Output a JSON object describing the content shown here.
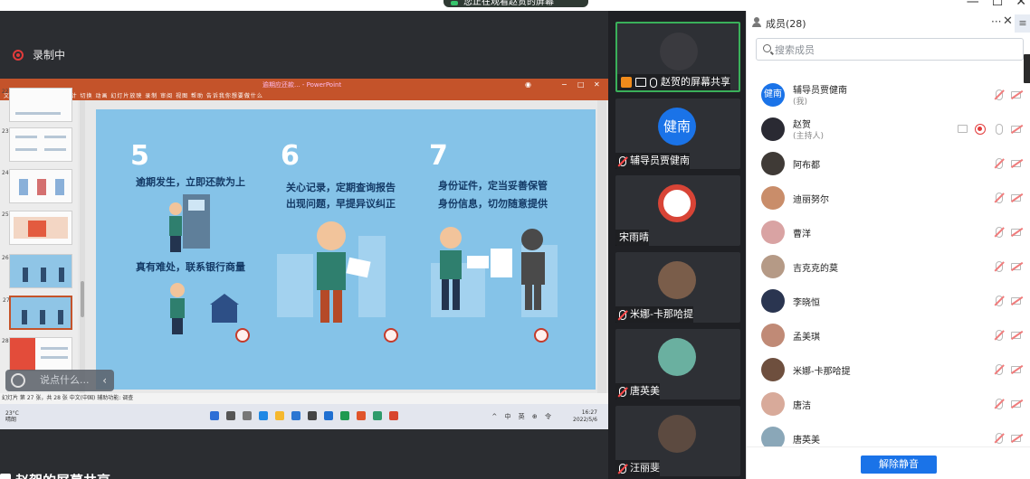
{
  "window": {
    "share_status": "您正在观看赵贺的屏幕",
    "controls": [
      "—",
      "☐",
      "✕"
    ]
  },
  "stage": {
    "recording_label": "录制中",
    "sharer_label": "赵贺的屏幕共享",
    "comment_placeholder": "说点什么...",
    "comment_toggle": "‹"
  },
  "ppt": {
    "title": "逾期应还款... - PowerPoint",
    "ribbon": "文件  开始  插入  绘图  设计  切换  动画  幻灯片放映  录制  审阅  视图  帮助  告诉我你想要做什么",
    "status": "幻灯片 第 27 张，共 28 张    中文(中国)    辅助功能: 调查",
    "thumb_numbers": [
      "22",
      "23",
      "24",
      "25",
      "26",
      "27",
      "28"
    ],
    "slide": {
      "num_5": "5",
      "num_6": "6",
      "num_7": "7",
      "text_5a": "逾期发生，立即还款为上",
      "text_5b": "真有难处，联系银行商量",
      "text_6a": "关心记录，定期查询报告",
      "text_6b": "出现问题，早提异议纠正",
      "text_7a": "身份证件，定当妥善保管",
      "text_7b": "身份信息，切勿随意提供"
    },
    "taskbar": {
      "weather_temp": "23°C",
      "weather_desc": "晴朗",
      "tray": "^ 中 英 ⊕ 令",
      "time": "16:27",
      "date": "2022/5/6"
    }
  },
  "videos": [
    {
      "name": "赵贺的屏幕共享",
      "avatar_color": "#3a3a3f",
      "avatar_text": "",
      "active": true,
      "badge": "host-share"
    },
    {
      "name": "辅导员贾健南",
      "avatar_color": "#1a73e8",
      "avatar_text": "健南",
      "active": false,
      "badge": "mic-off"
    },
    {
      "name": "宋雨晴",
      "avatar_color": "#d84436",
      "avatar_text": "",
      "active": false,
      "badge": "none"
    },
    {
      "name": "米娜-卡那哈提",
      "avatar_color": "#7a5d4a",
      "avatar_text": "",
      "active": false,
      "badge": "mic-off"
    },
    {
      "name": "唐英美",
      "avatar_color": "#6ab0a0",
      "avatar_text": "",
      "active": false,
      "badge": "mic-off"
    },
    {
      "name": "汪丽斐",
      "avatar_color": "#5c4a40",
      "avatar_text": "",
      "active": false,
      "badge": "mic-off"
    }
  ],
  "panel": {
    "title": "成员(28)",
    "more": "···",
    "close": "✕",
    "menu": "≡",
    "search_placeholder": "搜索成员",
    "unmute_all": "解除静音",
    "members": [
      {
        "name": "辅导员贾健南",
        "role": "(我)",
        "avatar_color": "#1a73e8",
        "avatar_text": "健南",
        "host": false
      },
      {
        "name": "赵贺",
        "role": "(主持人)",
        "avatar_color": "#2a2a33",
        "avatar_text": "",
        "host": true
      },
      {
        "name": "阿布都",
        "role": "",
        "avatar_color": "#3f3a36",
        "avatar_text": "",
        "host": false
      },
      {
        "name": "迪丽努尔",
        "role": "",
        "avatar_color": "#c98d6a",
        "avatar_text": "",
        "host": false
      },
      {
        "name": "曹洋",
        "role": "",
        "avatar_color": "#d9a3a3",
        "avatar_text": "",
        "host": false
      },
      {
        "name": "吉克克的莫",
        "role": "",
        "avatar_color": "#b59a86",
        "avatar_text": "",
        "host": false
      },
      {
        "name": "李晓恒",
        "role": "",
        "avatar_color": "#2a3550",
        "avatar_text": "",
        "host": false
      },
      {
        "name": "孟美琪",
        "role": "",
        "avatar_color": "#c08a76",
        "avatar_text": "",
        "host": false
      },
      {
        "name": "米娜-卡那哈提",
        "role": "",
        "avatar_color": "#6e4f3e",
        "avatar_text": "",
        "host": false
      },
      {
        "name": "唐洁",
        "role": "",
        "avatar_color": "#d8aa9a",
        "avatar_text": "",
        "host": false
      },
      {
        "name": "唐英美",
        "role": "",
        "avatar_color": "#8aa7b8",
        "avatar_text": "",
        "host": false
      }
    ]
  }
}
